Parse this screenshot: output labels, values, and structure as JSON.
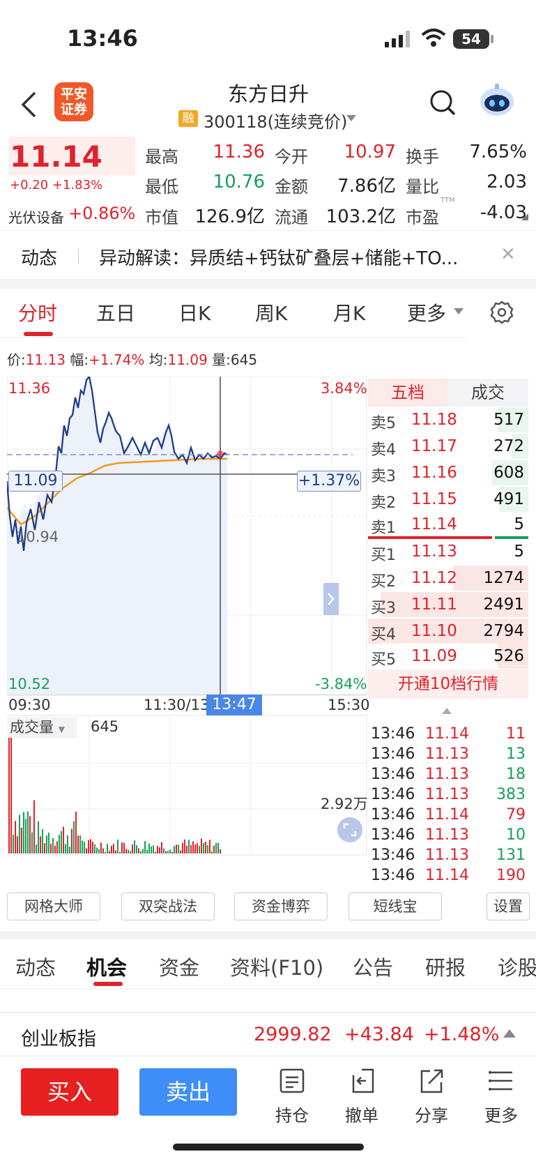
{
  "status": {
    "time": "13:46",
    "battery": "54"
  },
  "header": {
    "broker_logo": "平安\n证券",
    "stock_name": "东方日升",
    "rong": "融",
    "stock_code": "300118(连续竞价)"
  },
  "quote": {
    "price": "11.14",
    "change": "+0.20 +1.83%",
    "sector_label": "光伏设备",
    "sector_change": "+0.86%",
    "rows": [
      {
        "l1": "最高",
        "v1": "11.36",
        "l2": "今开",
        "v2": "10.97",
        "l3": "换手",
        "v3": "7.65%"
      },
      {
        "l1": "最低",
        "v1": "10.76",
        "l2": "金额",
        "v2": "7.86亿",
        "l3": "量比",
        "v3": "2.03"
      },
      {
        "l1": "市值",
        "v1": "126.9亿",
        "l2": "流通",
        "v2": "103.2亿",
        "l3": "市盈",
        "v3": "-4.03"
      }
    ],
    "pe_suffix": "TTM"
  },
  "news": {
    "tag": "动态",
    "text": "异动解读：异质结+钙钛矿叠层+储能+TO...",
    "close": "✕"
  },
  "chart_tabs": [
    "分时",
    "五日",
    "日K",
    "周K",
    "月K",
    "更多"
  ],
  "info_line": {
    "p_label": "价:",
    "p": "11.13",
    "f_label": "幅:",
    "f": "+1.74%",
    "a_label": "均:",
    "a": "11.09",
    "v_label": "量:",
    "v": "645"
  },
  "chart": {
    "y_top": "11.36",
    "y_mid": "10.94",
    "y_bottom": "10.52",
    "pct_top": "3.84%",
    "pct_bottom": "-3.84%",
    "cursor_price": "11.09",
    "cursor_pct": "+1.37%",
    "time_start": "09:30",
    "time_mid": "11:30/13",
    "time_cursor": "13:47",
    "time_end": "15:30",
    "volume_label": "成交量",
    "volume_value": "645",
    "volume_max": "2.92万"
  },
  "chart_data": {
    "type": "line",
    "series": [],
    "x": [
      "09:30",
      "10:00",
      "10:30",
      "11:00",
      "11:30",
      "13:00",
      "13:30",
      "13:46"
    ],
    "price": [
      11.02,
      11.12,
      11.34,
      11.16,
      11.15,
      11.19,
      11.13,
      11.13
    ],
    "avg": [
      10.96,
      11.01,
      11.06,
      11.07,
      11.08,
      11.08,
      11.09,
      11.09
    ],
    "ylim": [
      10.52,
      11.36
    ]
  },
  "orderbook": {
    "tab_active": "五档",
    "tab": "成交",
    "asks": [
      {
        "label": "卖5",
        "price": "11.18",
        "qty": "517"
      },
      {
        "label": "卖4",
        "price": "11.17",
        "qty": "272"
      },
      {
        "label": "卖3",
        "price": "11.16",
        "qty": "608"
      },
      {
        "label": "卖2",
        "price": "11.15",
        "qty": "491"
      },
      {
        "label": "卖1",
        "price": "11.14",
        "qty": "5"
      }
    ],
    "bids": [
      {
        "label": "买1",
        "price": "11.13",
        "qty": "5"
      },
      {
        "label": "买2",
        "price": "11.12",
        "qty": "1274"
      },
      {
        "label": "买3",
        "price": "11.11",
        "qty": "2491"
      },
      {
        "label": "买4",
        "price": "11.10",
        "qty": "2794"
      },
      {
        "label": "买5",
        "price": "11.09",
        "qty": "526"
      }
    ],
    "open10": "开通10档行情"
  },
  "ticks": [
    {
      "t": "13:46",
      "p": "11.14",
      "v": "11",
      "dir": "red"
    },
    {
      "t": "13:46",
      "p": "11.13",
      "v": "13",
      "dir": "green"
    },
    {
      "t": "13:46",
      "p": "11.13",
      "v": "18",
      "dir": "green"
    },
    {
      "t": "13:46",
      "p": "11.13",
      "v": "383",
      "dir": "green"
    },
    {
      "t": "13:46",
      "p": "11.14",
      "v": "79",
      "dir": "red"
    },
    {
      "t": "13:46",
      "p": "11.13",
      "v": "10",
      "dir": "green"
    },
    {
      "t": "13:46",
      "p": "11.13",
      "v": "131",
      "dir": "green"
    },
    {
      "t": "13:46",
      "p": "11.14",
      "v": "190",
      "dir": "red"
    }
  ],
  "tools": [
    "网格大师",
    "双突战法",
    "资金博弈",
    "短线宝",
    "设置"
  ],
  "bottom_tabs": [
    "动态",
    "机会",
    "资金",
    "资料(F10)",
    "公告",
    "研报",
    "诊股"
  ],
  "index": {
    "name": "创业板指",
    "value": "2999.82",
    "change": "+43.84",
    "pct": "+1.48%"
  },
  "actions": {
    "buy": "买入",
    "sell": "卖出",
    "hold": "持仓",
    "cancel": "撤单",
    "share": "分享",
    "more": "更多"
  }
}
